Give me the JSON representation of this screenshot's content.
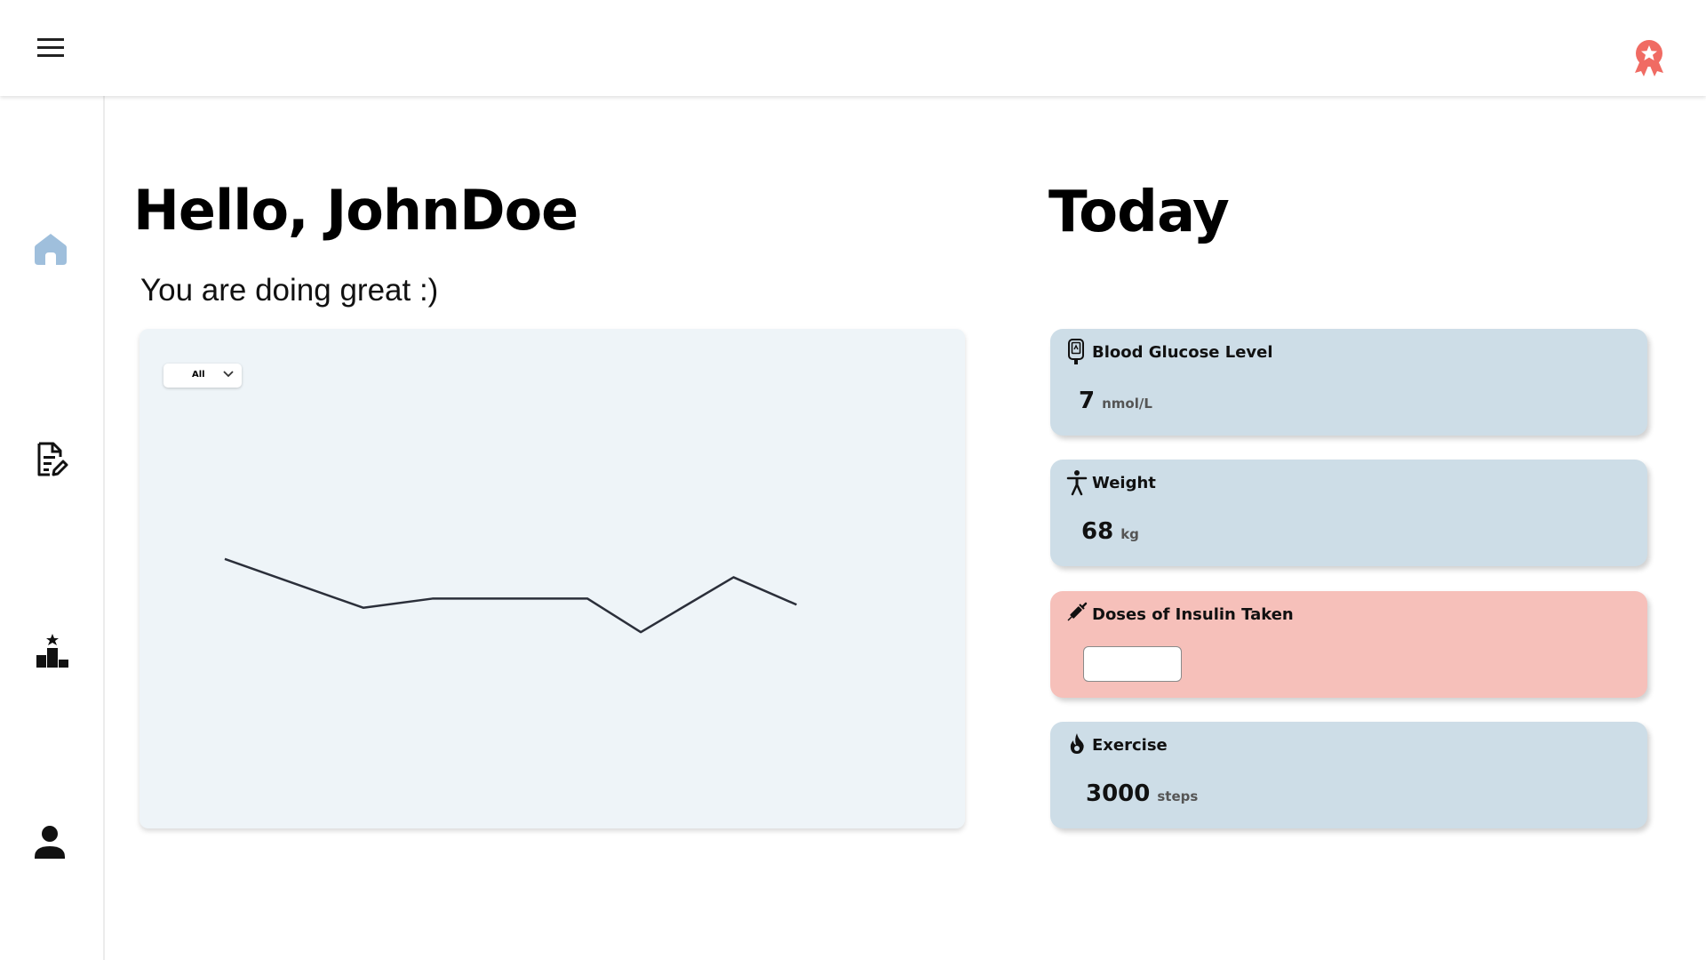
{
  "header": {
    "menu_icon": "menu-icon",
    "award_icon": "award-badge-icon",
    "award_color": "#f06b63"
  },
  "sidebar": {
    "items": [
      {
        "id": "home",
        "icon": "home-icon",
        "active": true,
        "color": "#9fbfdc"
      },
      {
        "id": "log",
        "icon": "edit-document-icon",
        "active": false,
        "color": "#000000"
      },
      {
        "id": "leaderboard",
        "icon": "leaderboard-icon",
        "active": false,
        "color": "#000000"
      },
      {
        "id": "profile",
        "icon": "person-icon",
        "active": false,
        "color": "#000000"
      }
    ]
  },
  "main": {
    "greeting": "Hello, JohnDoe",
    "subtitle": "You are doing great :)",
    "chart_filter": {
      "selected": "All"
    }
  },
  "today": {
    "title": "Today",
    "cards": {
      "glucose": {
        "title": "Blood Glucose Level",
        "value": "7",
        "unit": "nmol/L",
        "icon": "glucometer-icon"
      },
      "weight": {
        "title": "Weight",
        "value": "68",
        "unit": "kg",
        "icon": "person-standing-icon"
      },
      "insulin": {
        "title": "Doses of Insulin Taken",
        "value": "",
        "icon": "syringe-icon"
      },
      "exercise": {
        "title": "Exercise",
        "value": "3000",
        "unit": "steps",
        "icon": "flame-icon"
      }
    }
  },
  "colors": {
    "card_blue": "#cddde7",
    "card_red": "#f6c0ba",
    "chart_bg": "#eef4f8",
    "line": "#2b2f3a"
  },
  "chart_data": {
    "type": "line",
    "title": "",
    "xlabel": "",
    "ylabel": "",
    "grid": false,
    "series": [
      {
        "values": [
          8.2,
          6.6,
          6.9,
          6.9,
          6.9,
          5.8,
          7.6,
          6.7
        ]
      }
    ],
    "ylim": [
      0,
      14
    ]
  }
}
